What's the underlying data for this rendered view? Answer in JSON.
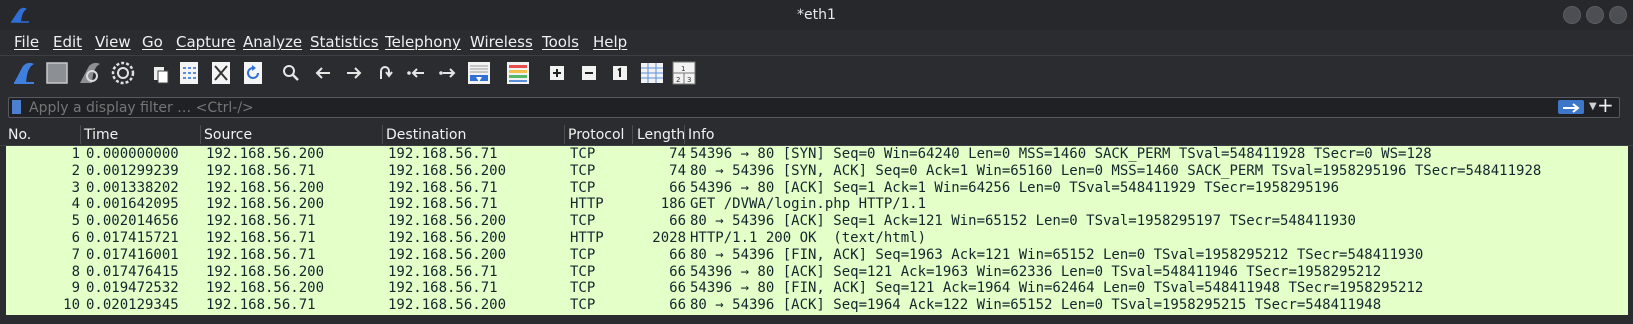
{
  "window": {
    "title": "*eth1"
  },
  "menu": [
    "File",
    "Edit",
    "View",
    "Go",
    "Capture",
    "Analyze",
    "Statistics",
    "Telephony",
    "Wireless",
    "Tools",
    "Help"
  ],
  "toolbar": {
    "icons": [
      "start-capture-icon",
      "stop-capture-icon",
      "restart-capture-icon",
      "capture-options-icon",
      "open-file-icon",
      "save-file-icon",
      "close-file-icon",
      "reload-file-icon",
      "find-packet-icon",
      "go-back-icon",
      "go-forward-icon",
      "go-to-packet-icon",
      "first-packet-icon",
      "last-packet-icon",
      "auto-scroll-icon",
      "colorize-icon",
      "zoom-in-icon",
      "zoom-out-icon",
      "normal-size-icon",
      "resize-columns-icon",
      "layout-icon"
    ]
  },
  "filter": {
    "placeholder": "Apply a display filter … <Ctrl-/>",
    "value": ""
  },
  "columns": [
    "No.",
    "Time",
    "Source",
    "Destination",
    "Protocol",
    "Length",
    "Info"
  ],
  "row_color": "#e4ffc7",
  "packets": [
    {
      "no": "1",
      "time": "0.000000000",
      "src": "192.168.56.200",
      "dst": "192.168.56.71",
      "proto": "TCP",
      "len": "74",
      "info": "54396 → 80 [SYN] Seq=0 Win=64240 Len=0 MSS=1460 SACK_PERM TSval=548411928 TSecr=0 WS=128"
    },
    {
      "no": "2",
      "time": "0.001299239",
      "src": "192.168.56.71",
      "dst": "192.168.56.200",
      "proto": "TCP",
      "len": "74",
      "info": "80 → 54396 [SYN, ACK] Seq=0 Ack=1 Win=65160 Len=0 MSS=1460 SACK_PERM TSval=1958295196 TSecr=548411928"
    },
    {
      "no": "3",
      "time": "0.001338202",
      "src": "192.168.56.200",
      "dst": "192.168.56.71",
      "proto": "TCP",
      "len": "66",
      "info": "54396 → 80 [ACK] Seq=1 Ack=1 Win=64256 Len=0 TSval=548411929 TSecr=1958295196"
    },
    {
      "no": "4",
      "time": "0.001642095",
      "src": "192.168.56.200",
      "dst": "192.168.56.71",
      "proto": "HTTP",
      "len": "186",
      "info": "GET /DVWA/login.php HTTP/1.1"
    },
    {
      "no": "5",
      "time": "0.002014656",
      "src": "192.168.56.71",
      "dst": "192.168.56.200",
      "proto": "TCP",
      "len": "66",
      "info": "80 → 54396 [ACK] Seq=1 Ack=121 Win=65152 Len=0 TSval=1958295197 TSecr=548411930"
    },
    {
      "no": "6",
      "time": "0.017415721",
      "src": "192.168.56.71",
      "dst": "192.168.56.200",
      "proto": "HTTP",
      "len": "2028",
      "info": "HTTP/1.1 200 OK  (text/html)"
    },
    {
      "no": "7",
      "time": "0.017416001",
      "src": "192.168.56.71",
      "dst": "192.168.56.200",
      "proto": "TCP",
      "len": "66",
      "info": "80 → 54396 [FIN, ACK] Seq=1963 Ack=121 Win=65152 Len=0 TSval=1958295212 TSecr=548411930"
    },
    {
      "no": "8",
      "time": "0.017476415",
      "src": "192.168.56.200",
      "dst": "192.168.56.71",
      "proto": "TCP",
      "len": "66",
      "info": "54396 → 80 [ACK] Seq=121 Ack=1963 Win=62336 Len=0 TSval=548411946 TSecr=1958295212"
    },
    {
      "no": "9",
      "time": "0.019472532",
      "src": "192.168.56.200",
      "dst": "192.168.56.71",
      "proto": "TCP",
      "len": "66",
      "info": "54396 → 80 [FIN, ACK] Seq=121 Ack=1964 Win=62464 Len=0 TSval=548411948 TSecr=1958295212"
    },
    {
      "no": "10",
      "time": "0.020129345",
      "src": "192.168.56.71",
      "dst": "192.168.56.200",
      "proto": "TCP",
      "len": "66",
      "info": "80 → 54396 [ACK] Seq=1964 Ack=122 Win=65152 Len=0 TSval=1958295215 TSecr=548411948"
    }
  ]
}
